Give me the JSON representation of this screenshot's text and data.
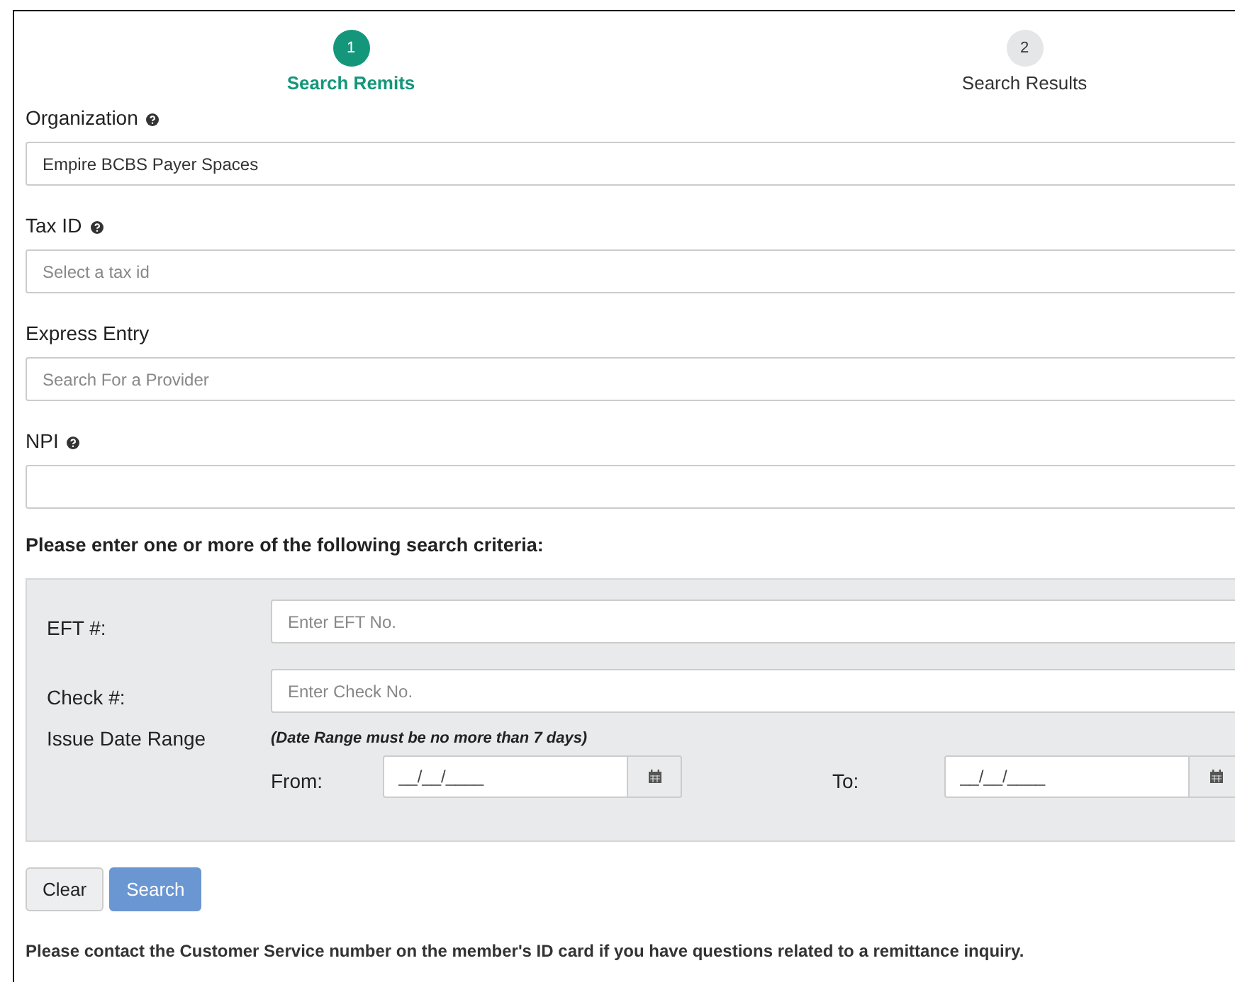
{
  "steps": [
    {
      "number": "1",
      "label": "Search Remits",
      "selected": true
    },
    {
      "number": "2",
      "label": "Search Results",
      "selected": false
    }
  ],
  "fields": [
    {
      "label": "Organization",
      "help": true,
      "value": "Empire BCBS Payer Spaces"
    },
    {
      "label": "Tax ID",
      "help": true,
      "placeholder": "Select a tax id"
    },
    {
      "label": "Express Entry",
      "help": false,
      "placeholder": "Search For a Provider"
    },
    {
      "label": "NPI",
      "help": true
    }
  ],
  "criteria_heading": "Please enter one or more of the following search criteria:",
  "criteria": {
    "rows": [
      {
        "label": "EFT #:",
        "placeholder": "Enter EFT No."
      },
      {
        "label": "Check #:",
        "placeholder": "Enter Check No."
      }
    ],
    "date_range": {
      "label": "Issue Date Range",
      "note": "(Date Range must be no more than 7 days)",
      "from": {
        "label": "From:",
        "placeholder": "__/__/____"
      },
      "to": {
        "label": "To:",
        "placeholder": "__/__/____"
      }
    }
  },
  "buttons": [
    {
      "label": "Clear",
      "kind": "secondary"
    },
    {
      "label": "Search",
      "kind": "primary"
    }
  ],
  "footer": "Please contact the Customer Service number on the member's ID card if you have questions related to a remittance inquiry."
}
